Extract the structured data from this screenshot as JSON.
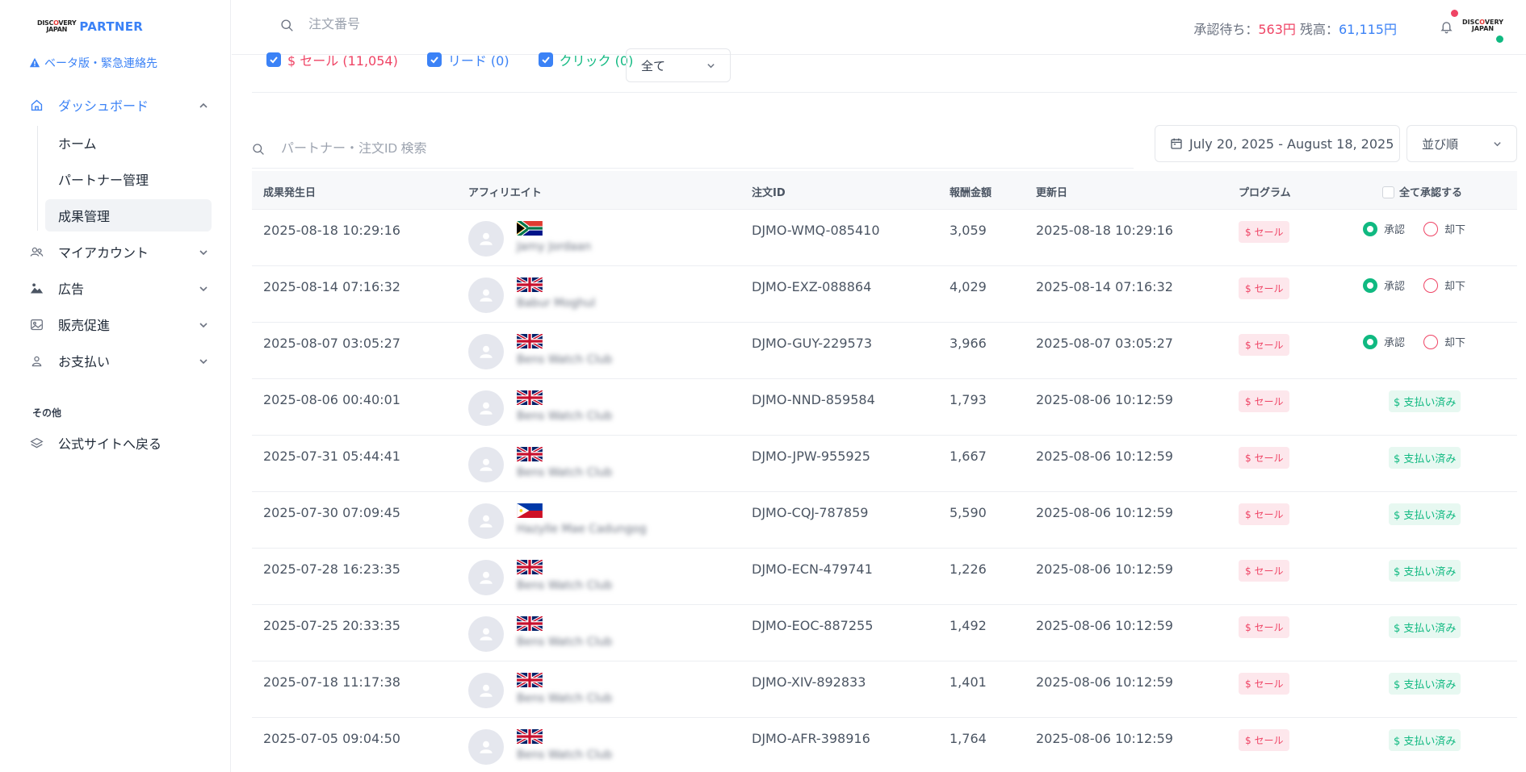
{
  "brand": {
    "logo_mark_line1": "DISC",
    "logo_mark_o": "O",
    "logo_mark_line1b": "VERY",
    "logo_mark_line2": "JAPAN",
    "name": "PARTNER"
  },
  "sidebar": {
    "beta_notice": "ベータ版・緊急連絡先",
    "nav": {
      "dashboard": "ダッシュボード",
      "sub_home": "ホーム",
      "sub_partners": "パートナー管理",
      "sub_results": "成果管理",
      "my_account": "マイアカウント",
      "ads": "広告",
      "promotion": "販売促進",
      "payments": "お支払い"
    },
    "section_other": "その他",
    "back_to_site": "公式サイトへ戻る"
  },
  "header": {
    "search_placeholder": "注文番号",
    "pending_label": "承認待ち：",
    "pending_value": "563円",
    "balance_label": "残高：",
    "balance_value": "61,115円",
    "accent_pending": "#ef4465",
    "accent_balance": "#3b82f6"
  },
  "filters": {
    "sale": "$ セール (11,054)",
    "lead": "リード (0)",
    "click": "クリック (0)",
    "type_selected": "全て"
  },
  "table_search": {
    "placeholder": "パートナー・注文ID 検索"
  },
  "date_range": "July 20, 2025 - August 18, 2025",
  "sort_label": "並び順",
  "table": {
    "headers": {
      "date": "成果発生日",
      "affiliate": "アフィリエイト",
      "order_id": "注文ID",
      "amount": "報酬金額",
      "updated": "更新日",
      "program": "プログラム",
      "approve_all": "全て承認する"
    },
    "program_label": "$ セール",
    "approve_label": "承認",
    "reject_label": "却下",
    "paid_label": "$ 支払い済み",
    "rows": [
      {
        "date": "2025-08-18 10:29:16",
        "flag": "za",
        "name": "Jamy Jordaan",
        "order_id": "DJMO-WMQ-085410",
        "amount": "3,059",
        "updated": "2025-08-18 10:29:16",
        "status": "pending"
      },
      {
        "date": "2025-08-14 07:16:32",
        "flag": "uk",
        "name": "Babur Moghul",
        "order_id": "DJMO-EXZ-088864",
        "amount": "4,029",
        "updated": "2025-08-14 07:16:32",
        "status": "pending"
      },
      {
        "date": "2025-08-07 03:05:27",
        "flag": "uk",
        "name": "Bens Watch Club",
        "order_id": "DJMO-GUY-229573",
        "amount": "3,966",
        "updated": "2025-08-07 03:05:27",
        "status": "pending"
      },
      {
        "date": "2025-08-06 00:40:01",
        "flag": "uk",
        "name": "Bens Watch Club",
        "order_id": "DJMO-NND-859584",
        "amount": "1,793",
        "updated": "2025-08-06 10:12:59",
        "status": "paid"
      },
      {
        "date": "2025-07-31 05:44:41",
        "flag": "uk",
        "name": "Bens Watch Club",
        "order_id": "DJMO-JPW-955925",
        "amount": "1,667",
        "updated": "2025-08-06 10:12:59",
        "status": "paid"
      },
      {
        "date": "2025-07-30 07:09:45",
        "flag": "ph",
        "name": "Hazylle Mae Cadungog",
        "order_id": "DJMO-CQJ-787859",
        "amount": "5,590",
        "updated": "2025-08-06 10:12:59",
        "status": "paid"
      },
      {
        "date": "2025-07-28 16:23:35",
        "flag": "uk",
        "name": "Bens Watch Club",
        "order_id": "DJMO-ECN-479741",
        "amount": "1,226",
        "updated": "2025-08-06 10:12:59",
        "status": "paid"
      },
      {
        "date": "2025-07-25 20:33:35",
        "flag": "uk",
        "name": "Bens Watch Club",
        "order_id": "DJMO-EOC-887255",
        "amount": "1,492",
        "updated": "2025-08-06 10:12:59",
        "status": "paid"
      },
      {
        "date": "2025-07-18 11:17:38",
        "flag": "uk",
        "name": "Bens Watch Club",
        "order_id": "DJMO-XIV-892833",
        "amount": "1,401",
        "updated": "2025-08-06 10:12:59",
        "status": "paid"
      },
      {
        "date": "2025-07-05 09:04:50",
        "flag": "uk",
        "name": "Bens Watch Club",
        "order_id": "DJMO-AFR-398916",
        "amount": "1,764",
        "updated": "2025-08-06 10:12:59",
        "status": "paid"
      }
    ]
  }
}
